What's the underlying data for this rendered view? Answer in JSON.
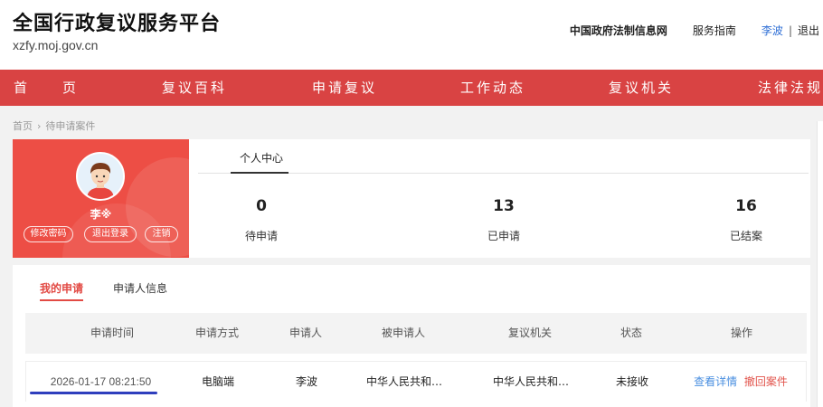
{
  "header": {
    "title": "全国行政复议服务平台",
    "domain": "xzfy.moj.gov.cn",
    "links": {
      "legal_network": "中国政府法制信息网",
      "service_guide": "服务指南",
      "user_name": "李波",
      "separator": "|",
      "logout": "退出"
    }
  },
  "nav": {
    "items": [
      "首　　页",
      "复议百科",
      "申请复议",
      "工作动态",
      "复议机关",
      "法律法规"
    ]
  },
  "breadcrumb": {
    "home": "首页",
    "arrow": "›",
    "current": "待申请案件"
  },
  "profile": {
    "name": "李※",
    "buttons": {
      "change_password": "修改密码",
      "logout": "退出登录",
      "deregister": "注销"
    }
  },
  "stats": {
    "tab": "个人中心",
    "items": [
      {
        "value": "0",
        "label": "待申请"
      },
      {
        "value": "13",
        "label": "已申请"
      },
      {
        "value": "16",
        "label": "已结案"
      }
    ]
  },
  "list": {
    "tabs": {
      "my_applications": "我的申请",
      "applicant_info": "申请人信息"
    },
    "columns": [
      "申请时间",
      "申请方式",
      "申请人",
      "被申请人",
      "复议机关",
      "状态",
      "操作"
    ],
    "rows": [
      {
        "time": "2026-01-17 08:21:50",
        "method": "电脑端",
        "applicant": "李波",
        "respondent": "中华人民共和…",
        "agency": "中华人民共和…",
        "status": "未接收",
        "actions": {
          "view": "查看详情",
          "withdraw": "撤回案件"
        }
      }
    ]
  },
  "colors": {
    "brand_red": "#d94343",
    "accent_red": "#e24a44",
    "link_blue": "#4a8fe0"
  }
}
